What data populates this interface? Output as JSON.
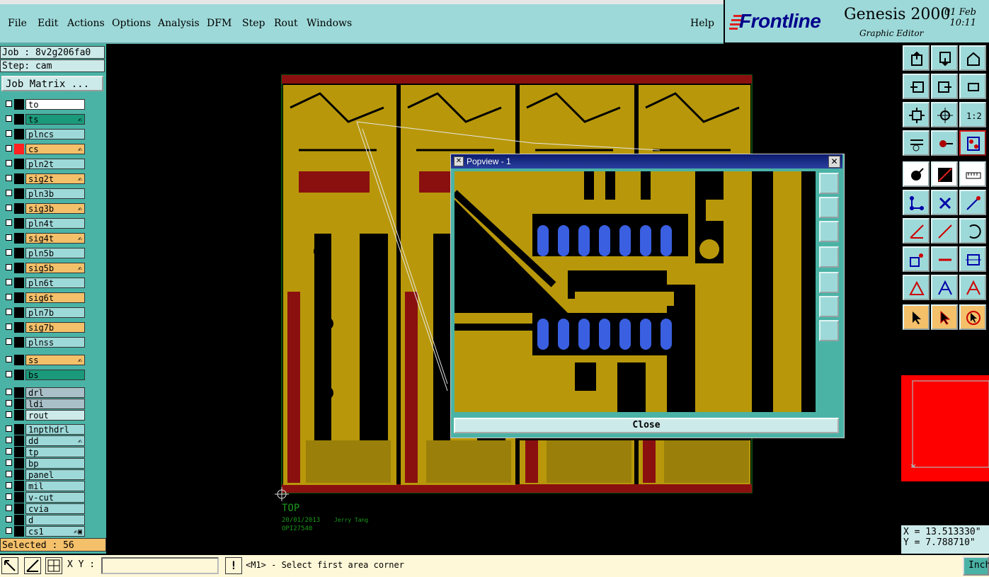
{
  "menu": {
    "items": [
      "File",
      "Edit",
      "Actions",
      "Options",
      "Analysis",
      "DFM",
      "Step",
      "Rout",
      "Windows"
    ],
    "help": "Help"
  },
  "branding": {
    "logo": "Frontline",
    "title": "Genesis 2000",
    "subtitle": "Graphic Editor",
    "date": "01 Feb",
    "time": "10:11"
  },
  "job": {
    "job_line": "Job : 8v2g206fa0",
    "step_line": "Step: cam",
    "matrix_button": "Job Matrix ..."
  },
  "layers": [
    {
      "name": "to",
      "color": "#ffffff",
      "mark": ""
    },
    {
      "name": "ts",
      "color": "#1a9a7a",
      "mark": "✍"
    },
    {
      "name": "plncs",
      "color": "#9ed9d9",
      "mark": ""
    },
    {
      "name": "cs",
      "color": "#f4c06a",
      "mark": "✍",
      "swatch": "#ff2020"
    },
    {
      "name": "pln2t",
      "color": "#9ed9d9",
      "mark": ""
    },
    {
      "name": "sig2t",
      "color": "#f4c06a",
      "mark": "✍"
    },
    {
      "name": "pln3b",
      "color": "#9ed9d9",
      "mark": ""
    },
    {
      "name": "sig3b",
      "color": "#f4c06a",
      "mark": "✍"
    },
    {
      "name": "pln4t",
      "color": "#9ed9d9",
      "mark": ""
    },
    {
      "name": "sig4t",
      "color": "#f4c06a",
      "mark": "✍"
    },
    {
      "name": "pln5b",
      "color": "#9ed9d9",
      "mark": ""
    },
    {
      "name": "sig5b",
      "color": "#f4c06a",
      "mark": "✍"
    },
    {
      "name": "pln6t",
      "color": "#9ed9d9",
      "mark": ""
    },
    {
      "name": "sig6t",
      "color": "#f4c06a",
      "mark": ""
    },
    {
      "name": "pln7b",
      "color": "#9ed9d9",
      "mark": ""
    },
    {
      "name": "sig7b",
      "color": "#f4c06a",
      "mark": ""
    },
    {
      "name": "plnss",
      "color": "#9ed9d9",
      "mark": ""
    },
    {
      "name": "ss",
      "color": "#f4c06a",
      "mark": "✍"
    },
    {
      "name": "bs",
      "color": "#1a9a7a",
      "mark": ""
    },
    {
      "name": "drl",
      "color": "#a9c0c8",
      "mark": ""
    },
    {
      "name": "ldi",
      "color": "#a9c0c8",
      "mark": ""
    },
    {
      "name": "rout",
      "color": "#cdeaea",
      "mark": ""
    },
    {
      "name": "1npthdrl",
      "color": "#9ed9d9",
      "mark": ""
    },
    {
      "name": "dd",
      "color": "#9ed9d9",
      "mark": "✍"
    },
    {
      "name": "tp",
      "color": "#9ed9d9",
      "mark": ""
    },
    {
      "name": "bp",
      "color": "#9ed9d9",
      "mark": ""
    },
    {
      "name": "panel",
      "color": "#9ed9d9",
      "mark": ""
    },
    {
      "name": "mil",
      "color": "#9ed9d9",
      "mark": ""
    },
    {
      "name": "v-cut",
      "color": "#9ed9d9",
      "mark": ""
    },
    {
      "name": "cvia",
      "color": "#9ed9d9",
      "mark": ""
    },
    {
      "name": "d",
      "color": "#9ed9d9",
      "mark": ""
    },
    {
      "name": "cs1",
      "color": "#9ed9d9",
      "mark": "✍▣"
    }
  ],
  "selected": "Selected : 56",
  "canvas": {
    "top_label": "TOP",
    "date_label": "20/01/2013",
    "author_label": "Jerry Tang",
    "part_label": "OPI27540"
  },
  "popview": {
    "title": "Popview - 1",
    "close_button": "Close"
  },
  "coords": {
    "x": "X = 13.513330\"",
    "y": "Y = 7.788710\""
  },
  "statusbar": {
    "xy_label": "X Y :",
    "xy_value": "",
    "message": "<M1> - Select first area corner",
    "units": "Inch"
  },
  "colors": {
    "panel_teal": "#9ed9d9",
    "copper": "#b8980a",
    "pad_blue": "#3a5fe0",
    "active_layer": "#f4c06a"
  }
}
